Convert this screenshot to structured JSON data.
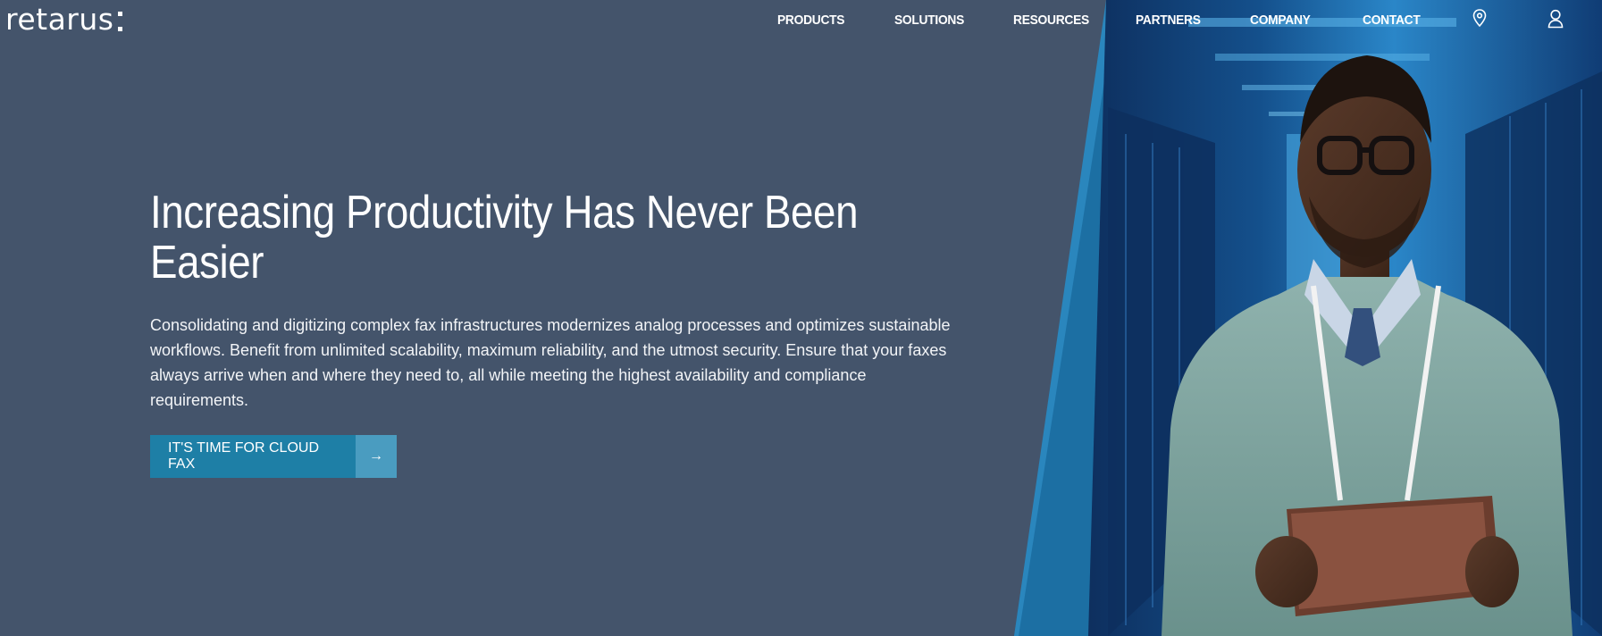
{
  "header": {
    "logo_text": "retarus",
    "nav": [
      {
        "label": "PRODUCTS"
      },
      {
        "label": "SOLUTIONS"
      },
      {
        "label": "RESOURCES"
      },
      {
        "label": "PARTNERS"
      },
      {
        "label": "COMPANY"
      },
      {
        "label": "CONTACT"
      }
    ],
    "icons": [
      "location-pin-icon",
      "user-account-icon"
    ]
  },
  "hero": {
    "title": "Increasing Productivity Has Never Been Easier",
    "text": "Consolidating and digitizing complex fax infrastructures modernizes analog processes and optimizes sustainable workflows. Benefit from unlimited scalability, maximum reliability, and the utmost security. Ensure that your faxes always arrive when and where they need to, all while meeting the highest availability and compliance requirements.",
    "cta_label": "IT'S TIME FOR CLOUD FAX",
    "cta_arrow": "→"
  },
  "colors": {
    "background": "#44546b",
    "cta": "#1e7fa6",
    "cta_arrow_bg": "#4a9cc0",
    "accent_stripe": "#1c6fa3"
  }
}
